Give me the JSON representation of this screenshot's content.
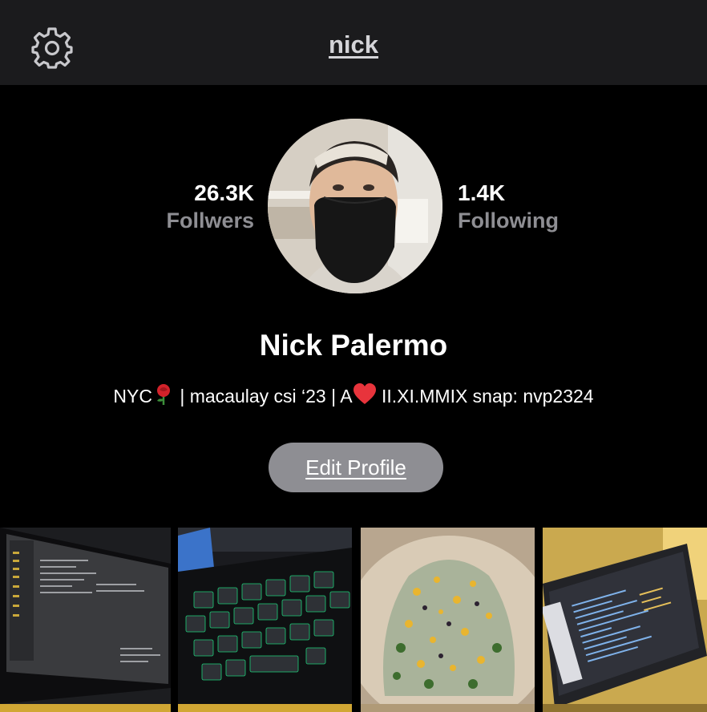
{
  "header": {
    "title": "nick",
    "settings_icon": "gear-icon"
  },
  "stats": {
    "followers_count": "26.3K",
    "followers_label": "Follwers",
    "following_count": "1.4K",
    "following_label": "Following"
  },
  "profile": {
    "name": "Nick Palermo",
    "bio_part1": "NYC",
    "bio_emoji1": "rose-emoji",
    "bio_part2": " | macaulay csi ‘23 | A",
    "bio_emoji2": "red-heart-emoji",
    "bio_part3": " II.XI.MMIX snap: nvp2324",
    "edit_button_label": "Edit Profile"
  },
  "colors": {
    "top_bar_bg": "#1b1b1d",
    "page_bg": "#000000",
    "muted_text": "#8e8e93",
    "button_bg": "#8e8e93"
  },
  "grid": {
    "photos": [
      {
        "name": "photo-monitor-code",
        "subject": "monitor"
      },
      {
        "name": "photo-keyboard",
        "subject": "keyboard"
      },
      {
        "name": "photo-food-bowl",
        "subject": "food"
      },
      {
        "name": "photo-laptop-code",
        "subject": "laptop"
      }
    ]
  }
}
